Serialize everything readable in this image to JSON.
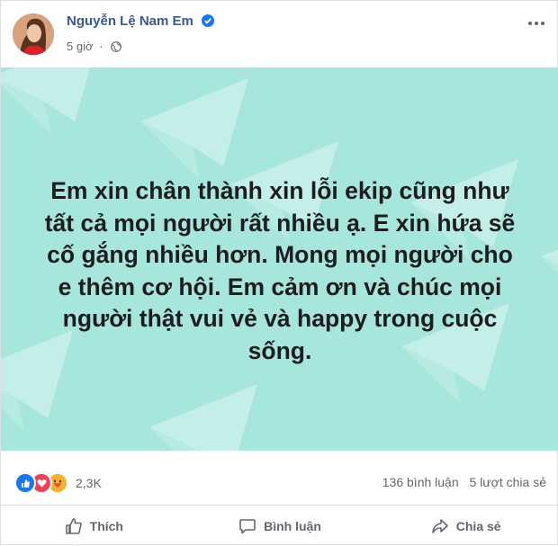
{
  "post": {
    "author": "Nguyễn Lệ Nam Em",
    "time": "5 giờ",
    "lines": [
      "Em xin chân thành xin lỗi ekip cũng như",
      "tất cả mọi người rất nhiều ạ. E xin hứa sẽ",
      "cố gắng nhiều hơn. Mong mọi người cho",
      "e thêm cơ hội. Em cảm ơn và chúc mọi",
      "người thật vui vẻ và happy trong cuộc",
      "sống."
    ]
  },
  "stats": {
    "reactions_count": "2,3K",
    "comments": "136 bình luận",
    "shares": "5 lượt chia sẻ"
  },
  "actions": {
    "like": "Thích",
    "comment": "Bình luận",
    "share": "Chia sẻ"
  },
  "colors": {
    "accent": "#385898",
    "post_background": "#a7e6dc",
    "plane": "#c4efe8"
  },
  "icons": [
    "verified-badge-icon",
    "globe-icon",
    "more-options-icon",
    "like-reaction-icon",
    "love-reaction-icon",
    "care-reaction-icon",
    "thumbs-up-icon",
    "comment-icon",
    "share-icon"
  ]
}
